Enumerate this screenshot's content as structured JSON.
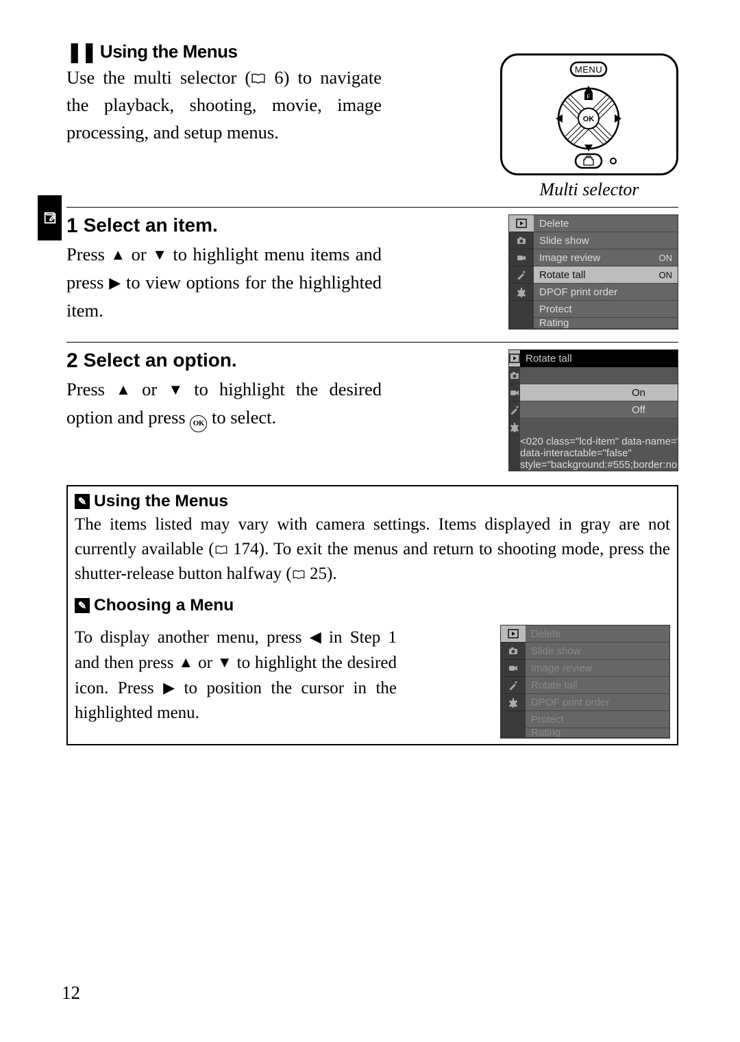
{
  "page_number": "12",
  "tab_icon": "note-icon",
  "header": {
    "title": "Using the Menus",
    "intro_before_ref": "Use the multi selector (",
    "intro_ref": "6",
    "intro_after_ref": ") to navigate the playback, shooting, movie, image processing, and setup menus."
  },
  "selector": {
    "menu_label": "MENU",
    "ok_label": "OK",
    "caption": "Multi selector"
  },
  "steps": [
    {
      "num": "1",
      "title": "Select an item.",
      "body_parts": [
        "Press ",
        " or ",
        " to highlight menu items and press ",
        " to view options for the highlighted item."
      ],
      "lcd": {
        "side_icons": [
          "playback",
          "shooting",
          "movie",
          "retouch",
          "setup"
        ],
        "selected_side": 0,
        "items": [
          {
            "label": "Delete",
            "value": "",
            "hl": false
          },
          {
            "label": "Slide show",
            "value": "",
            "hl": false
          },
          {
            "label": "Image review",
            "value": "ON",
            "hl": false
          },
          {
            "label": "Rotate tall",
            "value": "ON",
            "hl": true
          },
          {
            "label": "DPOF print order",
            "value": "",
            "hl": false
          },
          {
            "label": "Protect",
            "value": "",
            "hl": false
          },
          {
            "label": "Rating",
            "value": "",
            "hl": false
          }
        ]
      }
    },
    {
      "num": "2",
      "title": "Select an option.",
      "body_parts": [
        "Press ",
        " or ",
        " to highlight the desired option and press ",
        " to select."
      ],
      "lcd": {
        "side_icons": [
          "playback",
          "shooting",
          "movie",
          "retouch",
          "setup"
        ],
        "selected_side": 0,
        "head": "Rotate tall",
        "items": [
          {
            "label": "",
            "value": "",
            "hl": false
          },
          {
            "label": "On",
            "value": "",
            "hl": true,
            "center": true
          },
          {
            "label": "Off",
            "value": "",
            "hl": false,
            "center": true
          },
          {
            "label": "",
            "value": "",
            "hl": false
          },
          {
            "label": "",
            "value": "",
            "hl": false
          }
        ]
      }
    }
  ],
  "notes": [
    {
      "title": "Using the Menus",
      "text_before_ref1": "The items listed may vary with camera settings. Items displayed in gray are not currently available (",
      "ref1": "174",
      "text_between": "). To exit the menus and return to shooting mode, press the shutter-release button halfway (",
      "ref2": "25",
      "text_after": ")."
    },
    {
      "title": "Choosing a Menu",
      "text_parts": [
        "To display another menu, press ",
        " in Step 1 and then press ",
        " or ",
        " to highlight the desired icon. Press ",
        " to position the cursor in the highlighted menu."
      ],
      "lcd": {
        "side_icons": [
          "playback",
          "shooting",
          "movie",
          "retouch",
          "setup"
        ],
        "selected_side": 0,
        "items": [
          {
            "label": "Delete",
            "value": "",
            "dim": true
          },
          {
            "label": "Slide show",
            "value": "",
            "dim": true
          },
          {
            "label": "Image review",
            "value": "",
            "dim": true
          },
          {
            "label": "Rotate tall",
            "value": "",
            "dim": true
          },
          {
            "label": "DPOF print order",
            "value": "",
            "dim": true
          },
          {
            "label": "Protect",
            "value": "",
            "dim": true
          },
          {
            "label": "Rating",
            "value": "",
            "dim": true
          }
        ]
      }
    }
  ],
  "glyphs": {
    "up": "▲",
    "down": "▼",
    "right": "▶",
    "left": "◀",
    "ok": "OK",
    "bars": "❚❚",
    "pencil": "✎",
    "book": "📖"
  }
}
